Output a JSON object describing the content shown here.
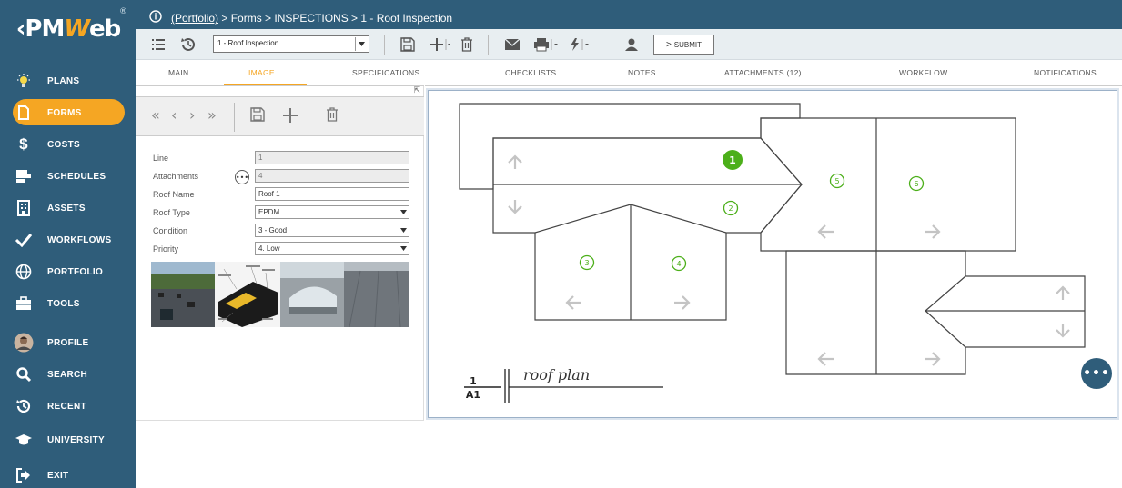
{
  "app": {
    "logo_prefix": "‹PM",
    "logo_w": "W",
    "logo_suffix": "eb",
    "logo_reg": "®"
  },
  "sidebar": {
    "items": [
      {
        "label": "PLANS",
        "icon": "lightbulb-icon"
      },
      {
        "label": "FORMS",
        "icon": "document-icon",
        "active": true
      },
      {
        "label": "COSTS",
        "icon": "dollar-icon"
      },
      {
        "label": "SCHEDULES",
        "icon": "gantt-icon"
      },
      {
        "label": "ASSETS",
        "icon": "building-icon"
      },
      {
        "label": "WORKFLOWS",
        "icon": "checkmark-icon"
      },
      {
        "label": "PORTFOLIO",
        "icon": "globe-icon"
      },
      {
        "label": "TOOLS",
        "icon": "briefcase-icon"
      },
      {
        "label": "PROFILE",
        "icon": "avatar-icon"
      },
      {
        "label": "SEARCH",
        "icon": "search-icon"
      },
      {
        "label": "RECENT",
        "icon": "history-icon"
      },
      {
        "label": "UNIVERSITY",
        "icon": "graduation-cap-icon"
      },
      {
        "label": "EXIT",
        "icon": "exit-icon"
      }
    ]
  },
  "breadcrumb": {
    "link": "(Portfolio)",
    "rest": " > Forms > INSPECTIONS > 1 - Roof Inspection"
  },
  "toolbar": {
    "record_value": "1 - Roof Inspection",
    "submit_label": "SUBMIT"
  },
  "tabs": [
    "MAIN",
    "IMAGE",
    "SPECIFICATIONS",
    "CHECKLISTS",
    "NOTES",
    "ATTACHMENTS (12)",
    "WORKFLOW",
    "NOTIFICATIONS"
  ],
  "form": {
    "fields": [
      {
        "label": "Line",
        "value": "1"
      },
      {
        "label": "Attachments",
        "value": "4"
      },
      {
        "label": "Roof Name",
        "value": "Roof 1"
      },
      {
        "label": "Roof Type",
        "value": "EPDM"
      },
      {
        "label": "Condition",
        "value": "3 - Good"
      },
      {
        "label": "Priority",
        "value": "4. Low"
      }
    ],
    "attach_btn": "•••"
  },
  "drawing": {
    "markers": [
      "1",
      "2",
      "3",
      "4",
      "5",
      "6"
    ],
    "caption_num": "1",
    "caption_sheet": "A1",
    "caption_title": "roof plan"
  },
  "colors": {
    "sidebar": "#2f5d7a",
    "accent": "#f5a623",
    "marker": "#4caf1a"
  },
  "fab_label": "•••"
}
